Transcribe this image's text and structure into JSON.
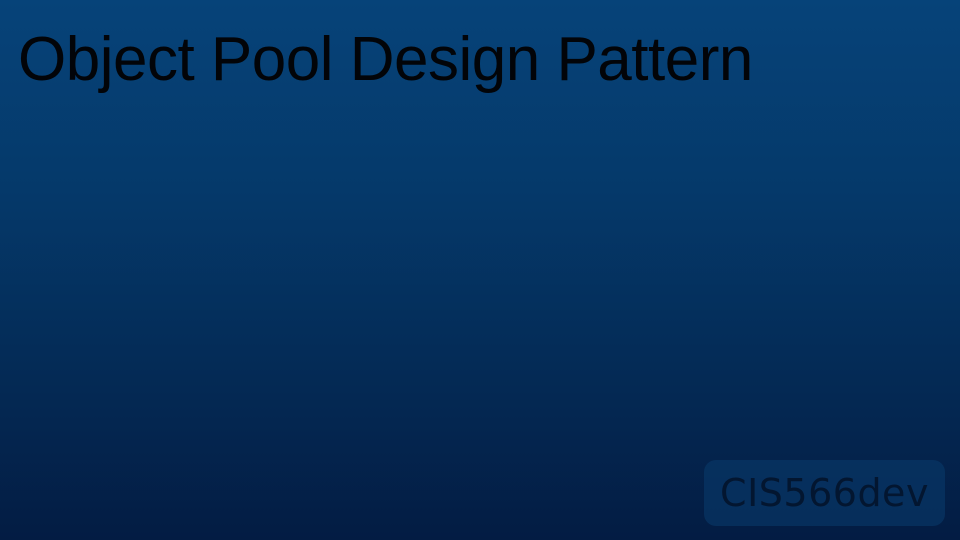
{
  "slide": {
    "title": "Object Pool Design Pattern"
  },
  "watermark": {
    "text": "CIS566dev"
  },
  "colors": {
    "background_top": "#064379",
    "background_bottom": "#031c43",
    "title_text": "#020408"
  }
}
